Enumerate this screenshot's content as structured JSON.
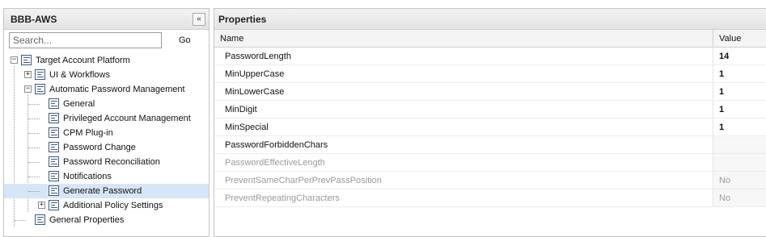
{
  "left_panel": {
    "title": "BBB-AWS",
    "collapse_label": "«",
    "search": {
      "placeholder": "Search...",
      "value": ""
    },
    "go_label": "Go",
    "tree": [
      {
        "label": "Target Account Platform",
        "level": 0,
        "expander": "−",
        "selected": false
      },
      {
        "label": "UI & Workflows",
        "level": 1,
        "expander": "+",
        "selected": false
      },
      {
        "label": "Automatic Password Management",
        "level": 1,
        "expander": "−",
        "selected": false
      },
      {
        "label": "General",
        "level": 2,
        "expander": "",
        "selected": false
      },
      {
        "label": "Privileged Account Management",
        "level": 2,
        "expander": "",
        "selected": false
      },
      {
        "label": "CPM Plug-in",
        "level": 2,
        "expander": "",
        "selected": false
      },
      {
        "label": "Password Change",
        "level": 2,
        "expander": "",
        "selected": false
      },
      {
        "label": "Password Reconciliation",
        "level": 2,
        "expander": "",
        "selected": false
      },
      {
        "label": "Notifications",
        "level": 2,
        "expander": "",
        "selected": false
      },
      {
        "label": "Generate Password",
        "level": 2,
        "expander": "",
        "selected": true
      },
      {
        "label": "Additional Policy Settings",
        "level": 2,
        "expander": "+",
        "selected": false
      },
      {
        "label": "General Properties",
        "level": 1,
        "expander": "",
        "selected": false
      }
    ]
  },
  "properties": {
    "title": "Properties",
    "columns": {
      "name": "Name",
      "value": "Value"
    },
    "rows": [
      {
        "name": "PasswordLength",
        "value": "14",
        "disabled": false
      },
      {
        "name": "MinUpperCase",
        "value": "1",
        "disabled": false
      },
      {
        "name": "MinLowerCase",
        "value": "1",
        "disabled": false
      },
      {
        "name": "MinDigit",
        "value": "1",
        "disabled": false
      },
      {
        "name": "MinSpecial",
        "value": "1",
        "disabled": false
      },
      {
        "name": "PasswordForbiddenChars",
        "value": "",
        "disabled": false
      },
      {
        "name": "PasswordEffectiveLength",
        "value": "",
        "disabled": true
      },
      {
        "name": "PreventSameCharPerPrevPassPosition",
        "value": "No",
        "disabled": true
      },
      {
        "name": "PreventRepeatingCharacters",
        "value": "No",
        "disabled": true
      }
    ]
  },
  "colors": {
    "selected_bg": "#d7e6f7",
    "disabled_text": "#9a9a9a",
    "icon_blue": "#3a5a8a"
  }
}
